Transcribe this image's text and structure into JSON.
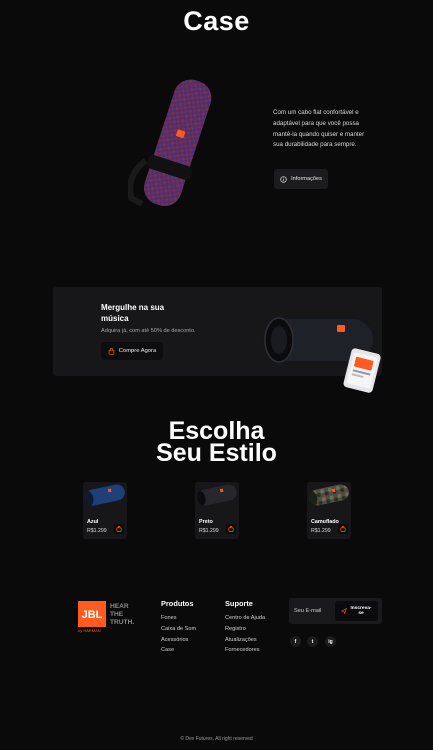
{
  "header": {
    "title": "Case"
  },
  "hero": {
    "description": "Com um cabo flat confortável e adaptável para que você possa mantê-la quando quiser e manter sua durabilidade para sempre.",
    "button_label": "Informações",
    "speaker_color": "#6b2d5c"
  },
  "promo": {
    "title": "Mergulhe na sua música",
    "subtitle": "Adquira já, com até 50% de desconto.",
    "button_label": "Compre Agora"
  },
  "styles": {
    "title_line1": "Escolha",
    "title_line2": "Seu Estilo",
    "products": [
      {
        "name": "Azul",
        "price": "R$1.299",
        "color": "#1f3f78"
      },
      {
        "name": "Preto",
        "price": "R$1.299",
        "color": "#1d1d22"
      },
      {
        "name": "Camuflado",
        "price": "R$1.299",
        "color": "#4a4f42"
      }
    ]
  },
  "footer": {
    "brand_logo": "JBL",
    "brand_tagline": "HEAR THE TRUTH.",
    "brand_sub": "by HARMAN",
    "products_heading": "Produtos",
    "products_links": [
      "Fones",
      "Caixa de Som",
      "Acessórios",
      "Case"
    ],
    "support_heading": "Suporte",
    "support_links": [
      "Centro de Ajuda",
      "Registro",
      "Atualizações",
      "Fornecedores"
    ],
    "newsletter_placeholder": "Seu E-mail",
    "newsletter_button": "Inscreva-se",
    "social": [
      "f",
      "t",
      "ig"
    ],
    "copyright": "© Dev Futures. All right reserved"
  },
  "colors": {
    "background": "#0a0a0a",
    "card": "#17171a",
    "accent": "#ff5a1f"
  }
}
